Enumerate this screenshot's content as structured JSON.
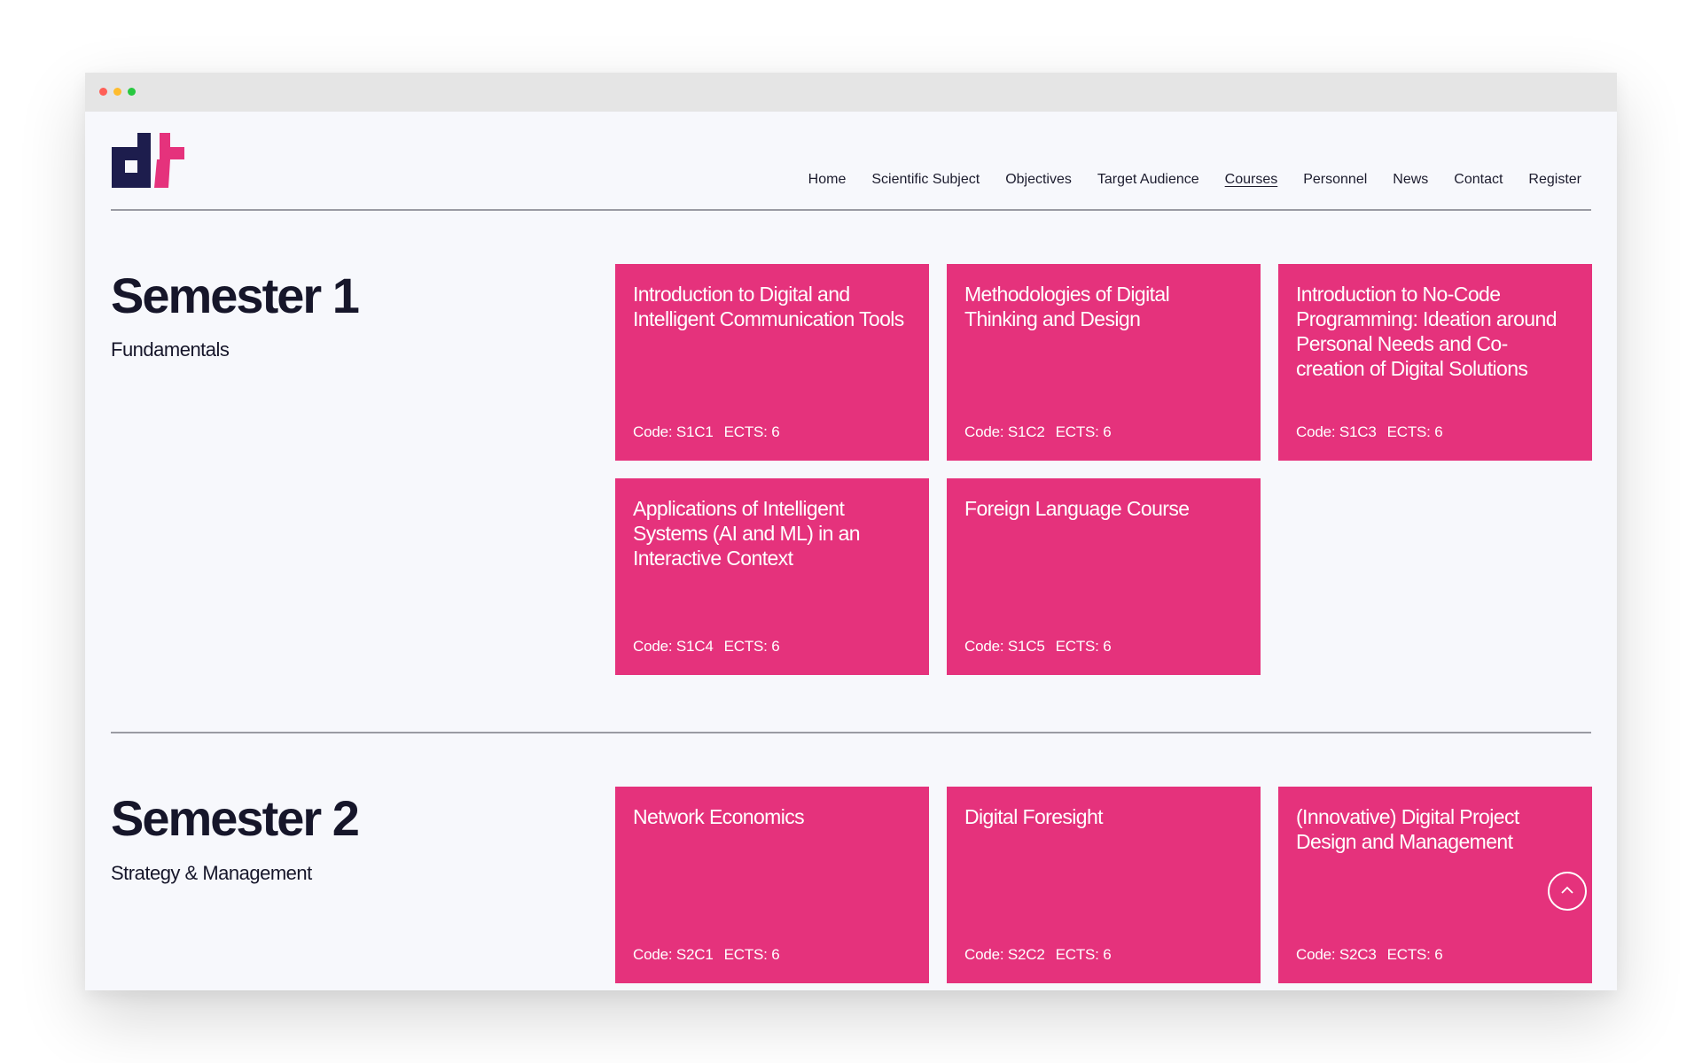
{
  "nav": {
    "items": [
      {
        "label": "Home"
      },
      {
        "label": "Scientific Subject"
      },
      {
        "label": "Objectives"
      },
      {
        "label": "Target Audience"
      },
      {
        "label": "Courses"
      },
      {
        "label": "Personnel"
      },
      {
        "label": "News"
      },
      {
        "label": "Contact"
      },
      {
        "label": "Register"
      }
    ],
    "active": "Courses"
  },
  "semesters": [
    {
      "title": "Semester 1",
      "subtitle": "Fundamentals",
      "courses": [
        {
          "title": "Introduction to Digital and Intelligent Communication Tools",
          "code": "Code: S1C1",
          "ects": "ECTS: 6"
        },
        {
          "title": "Methodologies of Digital Thinking and Design",
          "code": "Code: S1C2",
          "ects": "ECTS: 6"
        },
        {
          "title": "Introduction to No-Code Programming: Ideation around Personal Needs and Co-creation of Digital Solutions",
          "code": "Code: S1C3",
          "ects": "ECTS: 6"
        },
        {
          "title": "Applications of Intelligent Systems (AI and ML) in an Interactive Context",
          "code": "Code: S1C4",
          "ects": "ECTS: 6"
        },
        {
          "title": "Foreign Language Course",
          "code": "Code: S1C5",
          "ects": "ECTS: 6"
        }
      ]
    },
    {
      "title": "Semester 2",
      "subtitle": "Strategy & Management",
      "courses": [
        {
          "title": "Network Economics",
          "code": "Code: S2C1",
          "ects": "ECTS: 6"
        },
        {
          "title": "Digital Foresight",
          "code": "Code: S2C2",
          "ects": "ECTS: 6"
        },
        {
          "title": "(Innovative) Digital Project Design and Management",
          "code": "Code: S2C3",
          "ects": "ECTS: 6"
        }
      ]
    }
  ],
  "colors": {
    "accent": "#e5327c",
    "logo_dark": "#1d1d4d",
    "text": "#16162a",
    "page_bg": "#f7f8fc"
  },
  "icons": {
    "logo": "dt-logo",
    "scroll_top": "chevron-up-icon"
  }
}
